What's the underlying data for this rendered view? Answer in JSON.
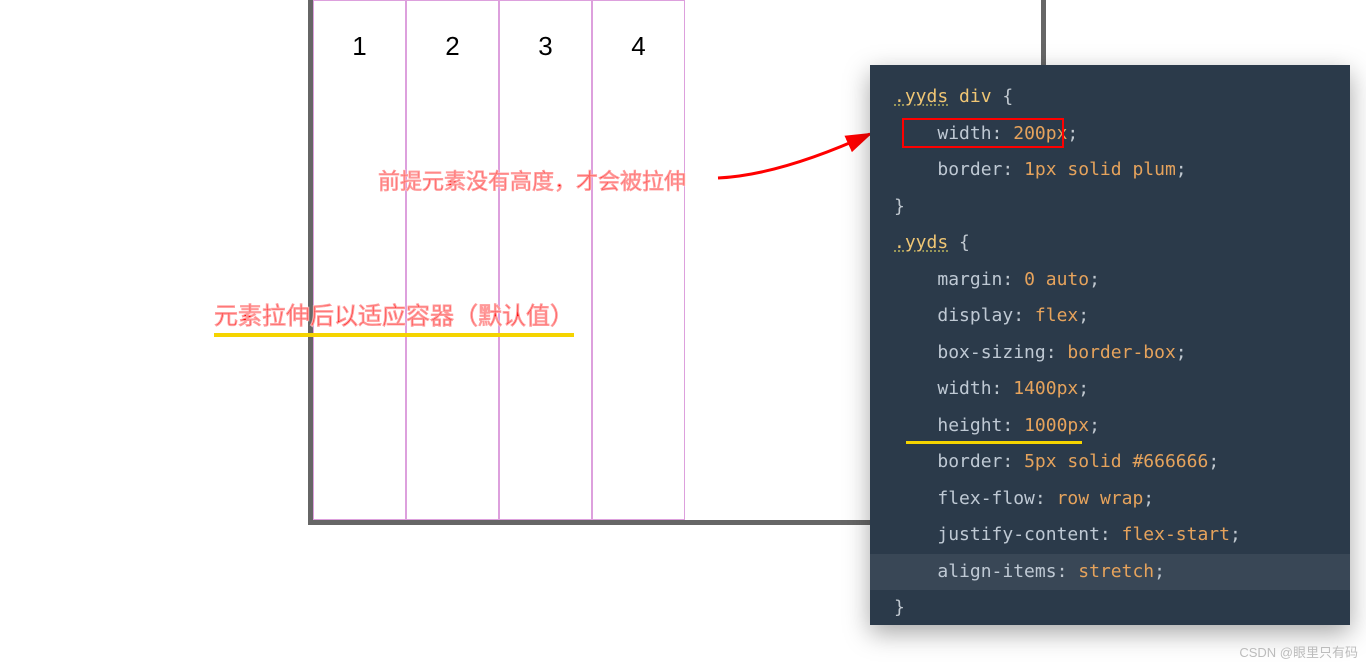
{
  "demo": {
    "items": [
      "1",
      "2",
      "3",
      "4"
    ]
  },
  "annotations": {
    "main": "元素拉伸后以适应容器（默认值）",
    "top": "前提元素没有高度，才会被拉伸"
  },
  "code": {
    "rule1": {
      "selector_class": ".yyds",
      "selector_tag": " div",
      "open": " {",
      "width_prop": "width",
      "width_val": "200px",
      "border_prop": "border",
      "border_val": "1px solid plum",
      "close": "}"
    },
    "rule2": {
      "selector_class": ".yyds",
      "open": " {",
      "margin_prop": "margin",
      "margin_val": "0 auto",
      "display_prop": "display",
      "display_val": "flex",
      "boxs_prop": "box-sizing",
      "boxs_val": "border-box",
      "width_prop": "width",
      "width_val": "1400px",
      "height_prop": "height",
      "height_val": "1000px",
      "border_prop": "border",
      "border_val": "5px solid #666666",
      "flow_prop": "flex-flow",
      "flow_val": "row wrap",
      "jc_prop": "justify-content",
      "jc_val": "flex-start",
      "ai_prop": "align-items",
      "ai_val": "stretch",
      "close": "}"
    }
  },
  "punct": {
    "colon": ": ",
    "semi": ";"
  },
  "watermark": "CSDN @眼里只有码"
}
